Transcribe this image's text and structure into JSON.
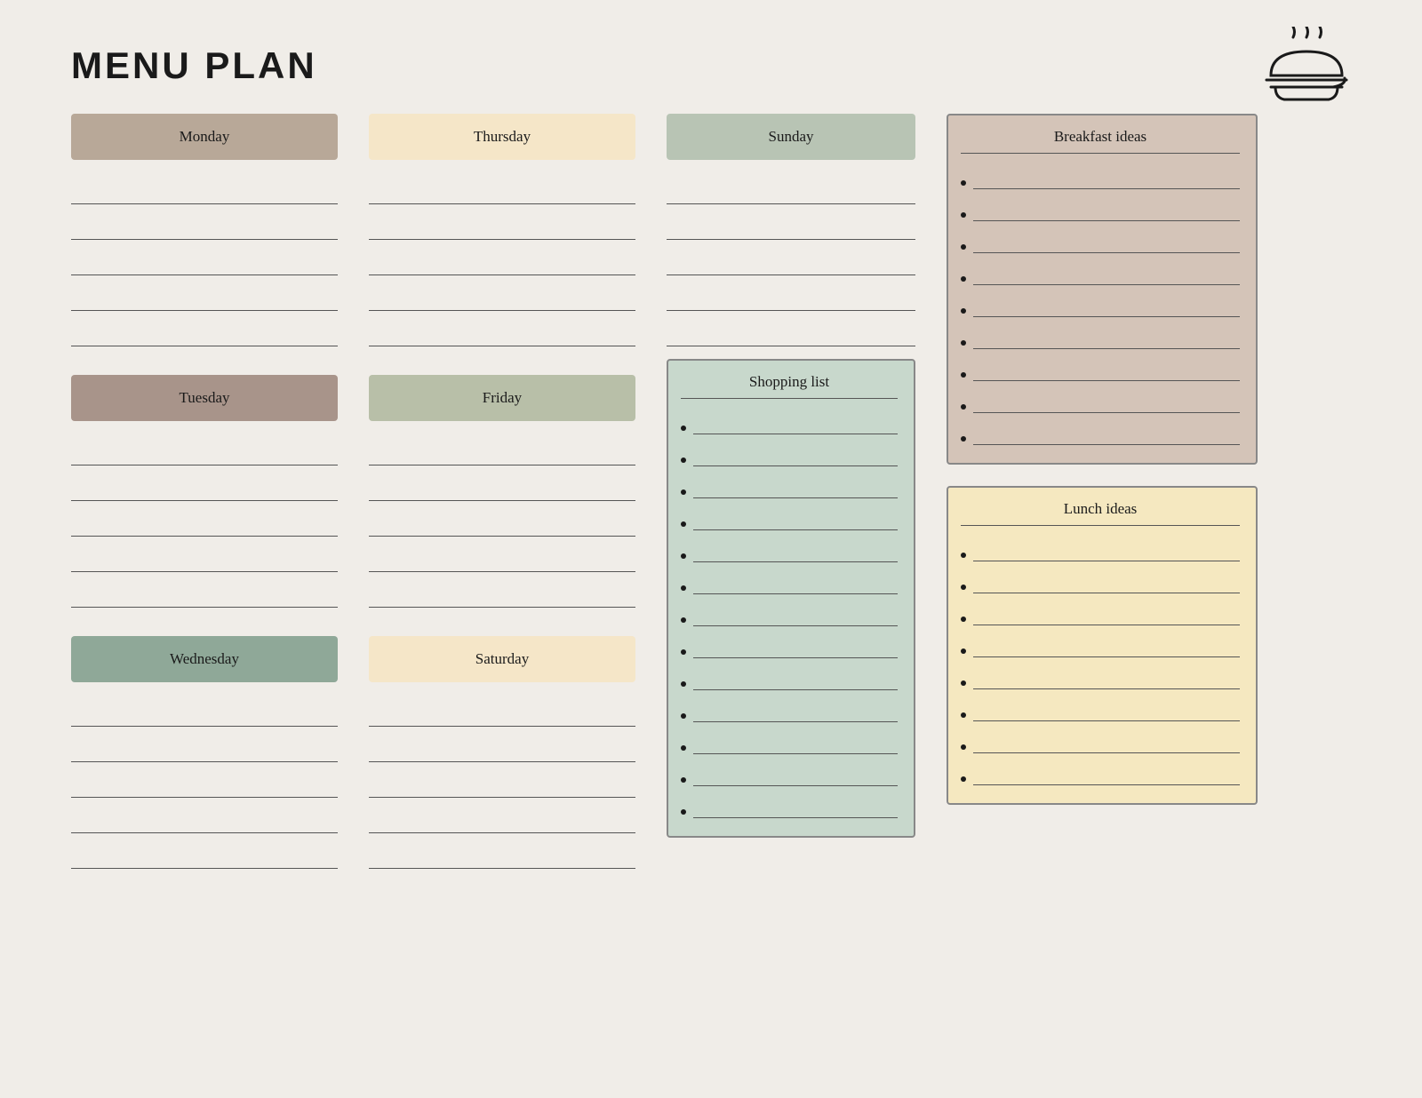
{
  "title": "MENU PLAN",
  "logo": {
    "alt": "food serving dish icon"
  },
  "days": {
    "monday": {
      "label": "Monday",
      "colorClass": "monday",
      "lines": 5
    },
    "tuesday": {
      "label": "Tuesday",
      "colorClass": "tuesday",
      "lines": 5
    },
    "wednesday": {
      "label": "Wednesday",
      "colorClass": "wednesday",
      "lines": 5
    },
    "thursday": {
      "label": "Thursday",
      "colorClass": "thursday",
      "lines": 5
    },
    "friday": {
      "label": "Friday",
      "colorClass": "friday",
      "lines": 5
    },
    "saturday": {
      "label": "Saturday",
      "colorClass": "saturday",
      "lines": 5
    },
    "sunday": {
      "label": "Sunday",
      "colorClass": "sunday",
      "lines": 5
    }
  },
  "shopping_list": {
    "title": "Shopping list",
    "items": 13
  },
  "breakfast_ideas": {
    "title": "Breakfast ideas",
    "items": 9
  },
  "lunch_ideas": {
    "title": "Lunch ideas",
    "items": 8
  }
}
